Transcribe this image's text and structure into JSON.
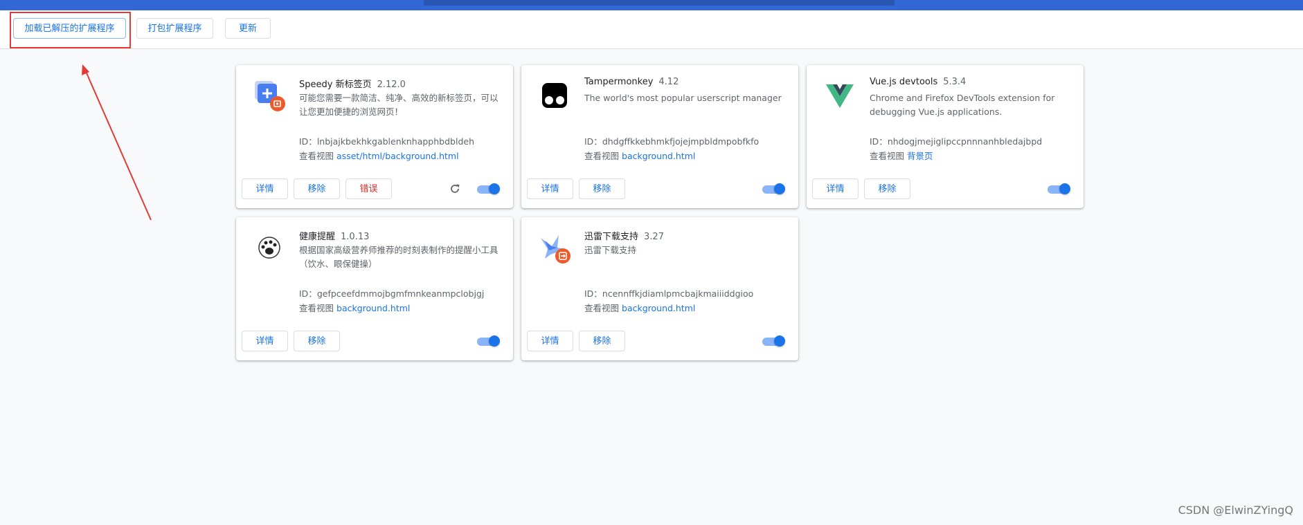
{
  "toolbar": {
    "load_unpacked_label": "加载已解压的扩展程序",
    "pack_label": "打包扩展程序",
    "update_label": "更新"
  },
  "labels": {
    "details": "详情",
    "remove": "移除",
    "errors": "错误",
    "id_prefix": "ID：",
    "inspect_views": "查看视图"
  },
  "extensions": [
    {
      "name": "Speedy 新标签页",
      "version": "2.12.0",
      "description": "可能您需要一款简洁、纯净、高效的新标签页，可以让您更加便捷的浏览网页！",
      "id": "lnbjajkbekhkgablenknhapphbdbldeh",
      "view": "asset/html/background.html",
      "icon": "speedy-icon",
      "enabled": true,
      "has_errors": true
    },
    {
      "name": "Tampermonkey",
      "version": "4.12",
      "description": "The world's most popular userscript manager",
      "id": "dhdgffkkebhmkfjojejmpbldmpobfkfo",
      "view": "background.html",
      "icon": "tampermonkey-icon",
      "enabled": true
    },
    {
      "name": "Vue.js devtools",
      "version": "5.3.4",
      "description": "Chrome and Firefox DevTools extension for debugging Vue.js applications.",
      "id": "nhdogjmejiglipccpnnnanhbledajbpd",
      "view": "背景页",
      "icon": "vue-icon",
      "enabled": true
    },
    {
      "name": "健康提醒",
      "version": "1.0.13",
      "description": "根据国家高级营养师推荐的时刻表制作的提醒小工具（饮水、眼保健操）",
      "id": "gefpceefdmmojbgmfmnkeanmpclobjgj",
      "view": "background.html",
      "icon": "paw-icon",
      "enabled": true
    },
    {
      "name": "迅雷下载支持",
      "version": "3.27",
      "description": "迅雷下载支持",
      "id": "ncennffkjdiamlpmcbajkmaiiiddgioo",
      "view": "background.html",
      "icon": "thunder-icon",
      "enabled": true
    }
  ],
  "colors": {
    "accent": "#1a73e8",
    "error": "#d93025",
    "annotation": "#e53935"
  },
  "watermark": "CSDN @ElwinZYingQ"
}
